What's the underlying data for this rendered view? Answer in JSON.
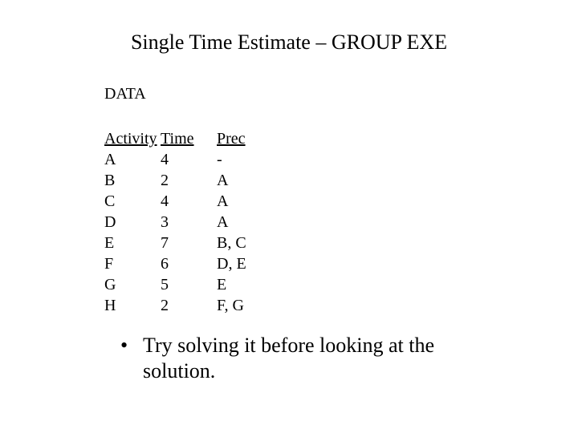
{
  "title": "Single Time Estimate – GROUP EXE",
  "section_label": "DATA",
  "headers": {
    "activity": "Activity",
    "time": "Time",
    "prec": "Prec"
  },
  "rows": [
    {
      "activity": "A",
      "time": "4",
      "prec": "-"
    },
    {
      "activity": "B",
      "time": "2",
      "prec": "A"
    },
    {
      "activity": "C",
      "time": "4",
      "prec": "A"
    },
    {
      "activity": "D",
      "time": "3",
      "prec": "A"
    },
    {
      "activity": "E",
      "time": "7",
      "prec": "B, C"
    },
    {
      "activity": "F",
      "time": "6",
      "prec": "D, E"
    },
    {
      "activity": "G",
      "time": "5",
      "prec": "E"
    },
    {
      "activity": "H",
      "time": "2",
      "prec": "F, G"
    }
  ],
  "bullet": {
    "marker": "•",
    "text": "Try solving it before looking at the solution."
  }
}
